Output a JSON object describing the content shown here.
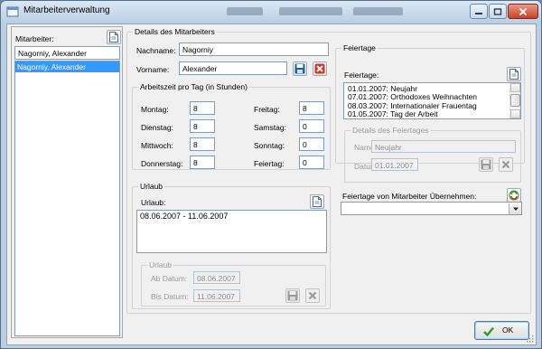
{
  "window": {
    "title": "Mitarbeiterverwaltung"
  },
  "employees": {
    "label": "Mitarbeiter:",
    "filter_value": "Nagorniy, Alexander",
    "items": [
      "Nagorniy, Alexander"
    ],
    "selected_index": 0
  },
  "details": {
    "legend": "Details des Mitarbeiters",
    "lastname_label": "Nachname:",
    "lastname_value": "Nagorniy",
    "firstname_label": "Vorname:",
    "firstname_value": "Alexander"
  },
  "worktime": {
    "legend": "Arbeitszeit pro Tag (in Stunden)",
    "days": [
      {
        "label": "Montag:",
        "value": "8"
      },
      {
        "label": "Dienstag:",
        "value": "8"
      },
      {
        "label": "Mittwoch:",
        "value": "8"
      },
      {
        "label": "Donnerstag:",
        "value": "8"
      },
      {
        "label": "Freitag:",
        "value": "8"
      },
      {
        "label": "Samstag:",
        "value": "0"
      },
      {
        "label": "Sonntag:",
        "value": "0"
      },
      {
        "label": "Feiertag:",
        "value": "0"
      }
    ]
  },
  "vacation": {
    "legend": "Urlaub",
    "list_label": "Urlaub:",
    "items": [
      "08.06.2007 - 11.06.2007"
    ],
    "detail_legend": "Urlaub",
    "from_label": "Ab Datum:",
    "from_value": "08.06.2007",
    "to_label": "Bis Datum:",
    "to_value": "11.06.2007"
  },
  "holidays": {
    "legend": "Feiertage",
    "list_label": "Feiertage:",
    "items": [
      "01.01.2007: Neujahr",
      "07.01.2007: Orthodoxes Weihnachten",
      "08.03.2007: Internationaler Frauentag",
      "01.05.2007: Tag der Arbeit"
    ],
    "detail_legend": "Details des Feiertages",
    "name_label": "Name",
    "name_value": "Neujahr",
    "date_label": "Datum",
    "date_value": "01.01.2007",
    "copy_label": "Feiertage von Mitarbeiter Übernehmen:",
    "copy_value": ""
  },
  "footer": {
    "ok_label": "OK"
  },
  "colors": {
    "selection": "#3399ff",
    "save_icon": "#1f5fa8",
    "delete_icon": "#d9321f",
    "ok_check": "#2e9e2e"
  }
}
